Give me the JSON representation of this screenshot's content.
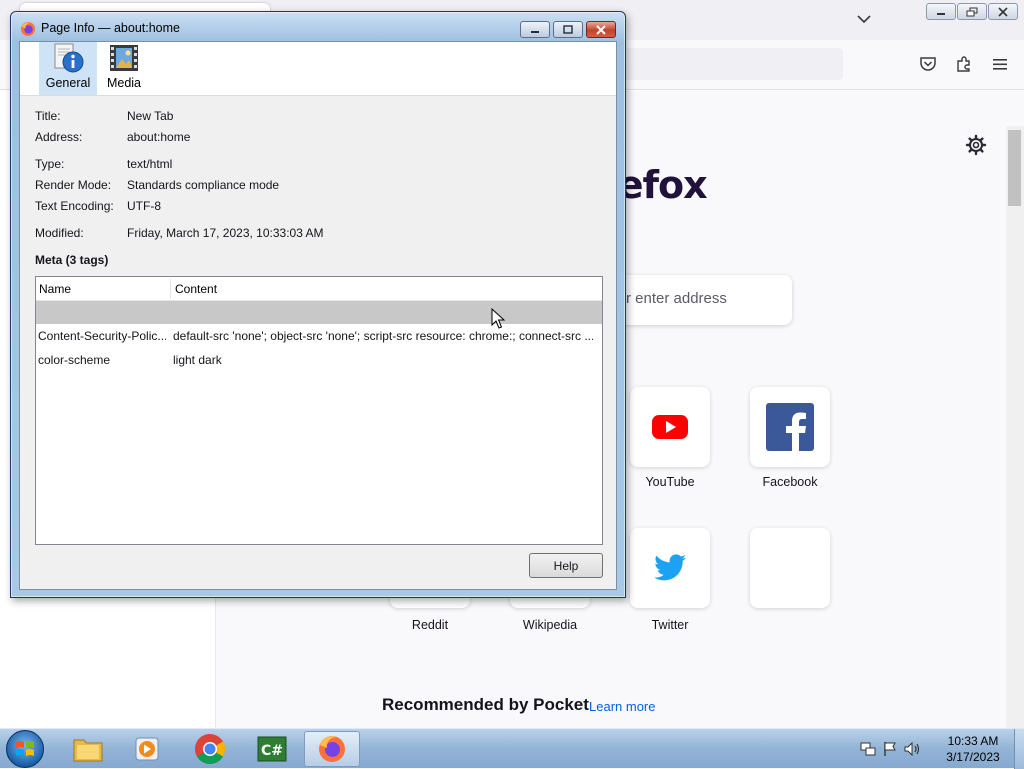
{
  "dialog": {
    "title": "Page Info — about:home",
    "tabs": [
      {
        "label": "General",
        "icon": "info-document-icon",
        "selected": true
      },
      {
        "label": "Media",
        "icon": "film-icon",
        "selected": false
      }
    ],
    "fields": {
      "title_label": "Title:",
      "title_value": "New Tab",
      "address_label": "Address:",
      "address_value": "about:home",
      "type_label": "Type:",
      "type_value": "text/html",
      "render_label": "Render Mode:",
      "render_value": "Standards compliance mode",
      "encoding_label": "Text Encoding:",
      "encoding_value": "UTF-8",
      "modified_label": "Modified:",
      "modified_value": "Friday, March 17, 2023, 10:33:03 AM"
    },
    "meta_heading": "Meta (3 tags)",
    "meta_table": {
      "columns": [
        "Name",
        "Content"
      ],
      "rows": [
        {
          "name": "",
          "content": ""
        },
        {
          "name": "Content-Security-Polic...",
          "content": "default-src 'none'; object-src 'none'; script-src resource: chrome:; connect-src ..."
        },
        {
          "name": "color-scheme",
          "content": "light dark"
        }
      ]
    },
    "help_label": "Help"
  },
  "browser": {
    "logo_text": "refox",
    "search_placeholder": "r enter address",
    "shortcuts": [
      {
        "label": "YouTube",
        "icon": "youtube-icon"
      },
      {
        "label": "Facebook",
        "icon": "facebook-icon"
      },
      {
        "label": "Reddit",
        "icon": "reddit-icon"
      },
      {
        "label": "Wikipedia",
        "icon": "wikipedia-icon"
      },
      {
        "label": "Twitter",
        "icon": "twitter-icon"
      },
      {
        "label": "",
        "icon": "empty-tile"
      }
    ],
    "pocket_heading": "Recommended by Pocket",
    "learn_more": "Learn more"
  },
  "taskbar": {
    "apps": [
      "explorer-icon",
      "media-player-icon",
      "chrome-icon",
      "csharp-icon",
      "firefox-icon"
    ],
    "clock_time": "10:33 AM",
    "clock_date": "3/17/2023"
  },
  "colors": {
    "youtube_red": "#ff0000",
    "facebook_blue": "#3b5998",
    "twitter_blue": "#1da1f2",
    "link_blue": "#0061e0"
  }
}
